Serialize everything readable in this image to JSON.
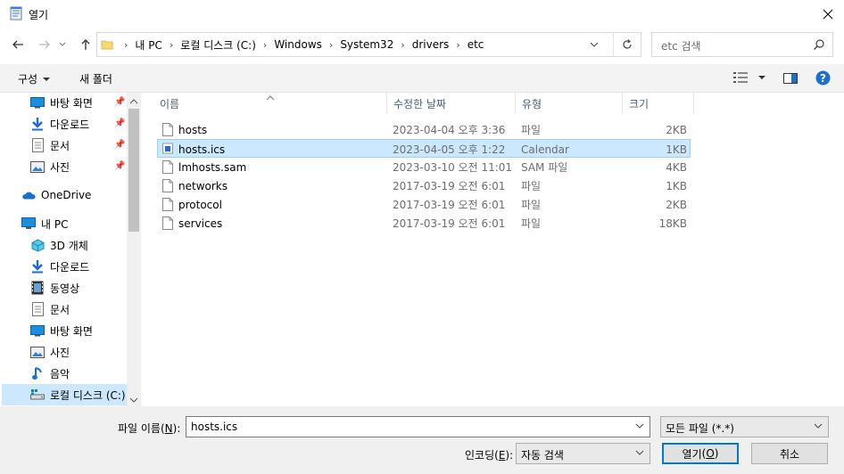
{
  "window": {
    "title": "열기"
  },
  "address": {
    "crumbs": [
      "내 PC",
      "로컬 디스크 (C:)",
      "Windows",
      "System32",
      "drivers",
      "etc"
    ]
  },
  "search": {
    "placeholder": "etc 검색"
  },
  "toolbar": {
    "organize": "구성",
    "new_folder": "새 폴더"
  },
  "nav": {
    "quick": [
      {
        "label": "바탕 화면",
        "icon": "desktop-icon"
      },
      {
        "label": "다운로드",
        "icon": "download-icon"
      },
      {
        "label": "문서",
        "icon": "document-icon"
      },
      {
        "label": "사진",
        "icon": "pictures-icon"
      }
    ],
    "onedrive": "OneDrive",
    "thispc": "내 PC",
    "pc_items": [
      {
        "label": "3D 개체",
        "icon": "3d-objects-icon"
      },
      {
        "label": "다운로드",
        "icon": "download-icon"
      },
      {
        "label": "동영상",
        "icon": "videos-icon"
      },
      {
        "label": "문서",
        "icon": "document-icon"
      },
      {
        "label": "바탕 화면",
        "icon": "desktop-icon"
      },
      {
        "label": "사진",
        "icon": "pictures-icon"
      },
      {
        "label": "음악",
        "icon": "music-icon"
      },
      {
        "label": "로컬 디스크 (C:)",
        "icon": "drive-icon"
      }
    ]
  },
  "columns": {
    "name": "이름",
    "date": "수정한 날짜",
    "type": "유형",
    "size": "크기"
  },
  "files": [
    {
      "name": "hosts",
      "date": "2023-04-04 오후 3:36",
      "type": "파일",
      "size": "2KB",
      "selected": false
    },
    {
      "name": "hosts.ics",
      "date": "2023-04-05 오후 1:22",
      "type": "Calendar",
      "size": "1KB",
      "selected": true
    },
    {
      "name": "lmhosts.sam",
      "date": "2023-03-10 오전 11:01",
      "type": "SAM 파일",
      "size": "4KB",
      "selected": false
    },
    {
      "name": "networks",
      "date": "2017-03-19 오전 6:01",
      "type": "파일",
      "size": "1KB",
      "selected": false
    },
    {
      "name": "protocol",
      "date": "2017-03-19 오전 6:01",
      "type": "파일",
      "size": "2KB",
      "selected": false
    },
    {
      "name": "services",
      "date": "2017-03-19 오전 6:01",
      "type": "파일",
      "size": "18KB",
      "selected": false
    }
  ],
  "bottom": {
    "filename_label": "파일 이름",
    "filename_key": "N",
    "filename_value": "hosts.ics",
    "filetype_value": "모든 파일 (*.*)",
    "encoding_label": "인코딩",
    "encoding_key": "E",
    "encoding_value": "자동 검색",
    "open_label": "열기",
    "open_key": "O",
    "cancel_label": "취소"
  },
  "colors": {
    "selection": "#cce8ff",
    "selection_border": "#99d1ff",
    "accent": "#0078d7",
    "help": "#1a6fd1"
  }
}
